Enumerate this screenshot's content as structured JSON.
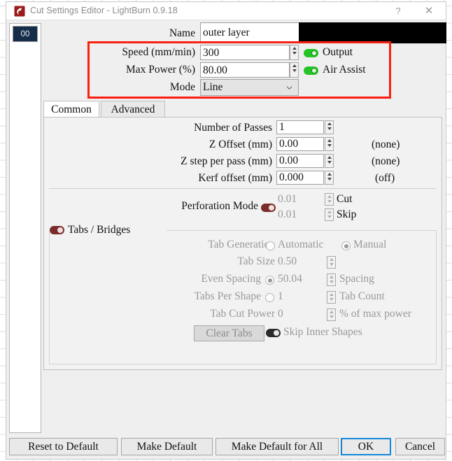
{
  "window": {
    "title": "Cut Settings Editor - LightBurn 0.9.18",
    "help_label": "?",
    "close_label": "✕",
    "logo_icon": "lightburn-logo-icon"
  },
  "layer_list": {
    "items": [
      {
        "label": "00",
        "color": "#162c48"
      }
    ]
  },
  "settings": {
    "name_label": "Name",
    "name_value": "outer layer",
    "swatch_color": "#000000",
    "speed_label": "Speed (mm/min)",
    "speed_value": "300",
    "max_power_label": "Max Power (%)",
    "max_power_value": "80.00",
    "mode_label": "Mode",
    "mode_value": "Line",
    "output_label": "Output",
    "output_on": true,
    "air_assist_label": "Air Assist",
    "air_assist_on": true,
    "annotation_color": "#fa2010"
  },
  "tabs": [
    {
      "label": "Common",
      "active": true
    },
    {
      "label": "Advanced",
      "active": false
    }
  ],
  "common": {
    "rows": [
      {
        "label": "Number of Passes",
        "value": "1",
        "suffix": ""
      },
      {
        "label": "Z Offset (mm)",
        "value": "0.00",
        "suffix": "(none)"
      },
      {
        "label": "Z step per pass (mm)",
        "value": "0.00",
        "suffix": "(none)"
      },
      {
        "label": "Kerf offset (mm)",
        "value": "0.000",
        "suffix": "(off)"
      }
    ],
    "perforation": {
      "label": "Perforation Mode",
      "enabled": false,
      "cut_value": "0.01",
      "cut_label": "Cut",
      "skip_value": "0.01",
      "skip_label": "Skip"
    },
    "tabs_bridges": {
      "label": "Tabs / Bridges",
      "enabled": false,
      "generation_label": "Tab Generation",
      "generation_automatic": "Automatic",
      "generation_manual": "Manual",
      "generation_selected": "Manual",
      "tab_size_label": "Tab Size",
      "tab_size_value": "0.50",
      "even_spacing_label": "Even Spacing",
      "even_spacing_value": "50.04",
      "even_spacing_suffix": "Spacing",
      "even_spacing_selected": true,
      "tabs_per_shape_label": "Tabs Per Shape",
      "tabs_per_shape_value": "1",
      "tabs_per_shape_suffix": "Tab Count",
      "tabs_per_shape_selected": false,
      "tab_cut_power_label": "Tab Cut Power",
      "tab_cut_power_value": "0",
      "tab_cut_power_suffix": "% of max power",
      "clear_tabs_label": "Clear Tabs",
      "skip_inner_label": "Skip Inner Shapes",
      "skip_inner_on": false
    }
  },
  "footer": {
    "reset_to_default": "Reset to Default",
    "make_default": "Make Default",
    "make_default_for_all": "Make Default for All",
    "ok": "OK",
    "cancel": "Cancel"
  }
}
